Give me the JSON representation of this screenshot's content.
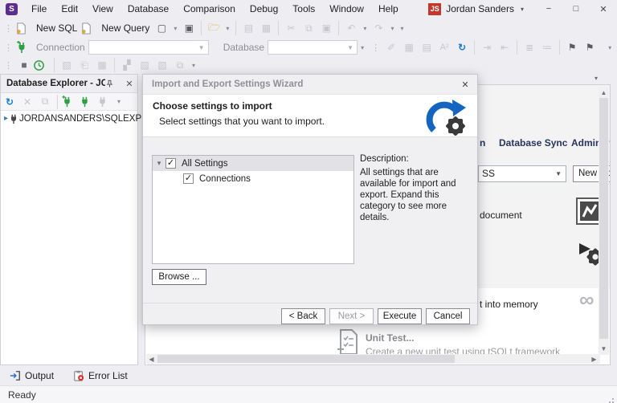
{
  "colors": {
    "accent_purple": "#5b2d90",
    "badge_red": "#c0392b",
    "plug_green": "#2f9e44",
    "refresh_blue": "#1f7ed0",
    "logo_blue": "#1565c0",
    "logo_gear": "#3a3a3a"
  },
  "titlebar": {
    "app_initial": "S",
    "menus": [
      "File",
      "Edit",
      "View",
      "Database",
      "Comparison",
      "Debug",
      "Tools",
      "Window",
      "Help"
    ],
    "user_initials": "JS",
    "user_name": "Jordan Sanders"
  },
  "toolbar": {
    "new_sql": "New SQL",
    "new_query": "New Query",
    "connection_label": "Connection",
    "database_label": "Database"
  },
  "explorer": {
    "title": "Database Explorer - JOR...",
    "server": "JORDANSANDERS\\SQLEXPRESS"
  },
  "document": {
    "tab_partial": "n",
    "tab_database_sync": "Database Sync",
    "tab_administration": "Administ",
    "connection_value_partial": "SS",
    "new_connection_partial": "New Con",
    "fragment_document": "document",
    "fragment_memory": "t into memory",
    "unit_test_title": "Unit Test...",
    "unit_test_desc": "Create a new unit test using tSQLt framework"
  },
  "dialog": {
    "title": "Import and Export Settings Wizard",
    "heading": "Choose settings to import",
    "subheading": "Select settings that you want to import.",
    "tree": [
      {
        "label": "All Settings"
      },
      {
        "label": "Connections"
      }
    ],
    "description_title": "Description:",
    "description_text": "All settings that are available for import and export. Expand this category to see more details.",
    "browse_label": "Browse ...",
    "back_label": "< Back",
    "next_label": "Next >",
    "execute_label": "Execute",
    "cancel_label": "Cancel"
  },
  "panels": {
    "output": "Output",
    "error_list": "Error List"
  },
  "statusbar": {
    "ready": "Ready"
  }
}
